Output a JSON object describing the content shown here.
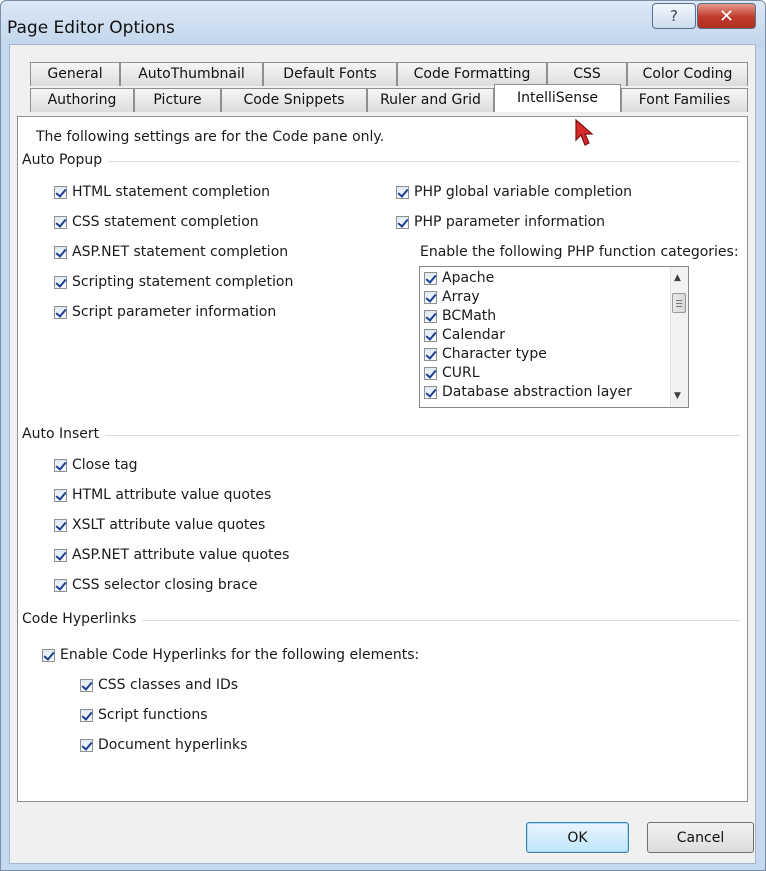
{
  "window": {
    "title": "Page Editor Options",
    "help_glyph": "?",
    "close_glyph": "✕"
  },
  "tabs": {
    "row1": [
      "General",
      "AutoThumbnail",
      "Default Fonts",
      "Code Formatting",
      "CSS",
      "Color Coding"
    ],
    "row2": [
      "Authoring",
      "Picture",
      "Code Snippets",
      "Ruler and Grid",
      "IntelliSense",
      "Font Families"
    ],
    "active": "IntelliSense"
  },
  "panel": {
    "intro": "The following settings are for the Code pane only.",
    "auto_popup": {
      "heading": "Auto Popup",
      "left_options": [
        "HTML statement completion",
        "CSS statement completion",
        "ASP.NET statement completion",
        "Scripting statement completion",
        "Script parameter information"
      ],
      "right_options": [
        "PHP global variable completion",
        "PHP parameter information"
      ],
      "php_label": "Enable the following PHP function categories:",
      "php_categories": [
        "Apache",
        "Array",
        "BCMath",
        "Calendar",
        "Character type",
        "CURL",
        "Database abstraction layer"
      ]
    },
    "auto_insert": {
      "heading": "Auto Insert",
      "options": [
        "Close tag",
        "HTML attribute value quotes",
        "XSLT attribute value quotes",
        "ASP.NET attribute value quotes",
        "CSS selector closing brace"
      ]
    },
    "code_hyperlinks": {
      "heading": "Code Hyperlinks",
      "enable": "Enable Code Hyperlinks for the following elements:",
      "options": [
        "CSS classes and IDs",
        "Script functions",
        "Document hyperlinks"
      ]
    },
    "all_checked": true
  },
  "buttons": {
    "ok": "OK",
    "cancel": "Cancel"
  },
  "colors": {
    "title_bar": "#c5d9ee",
    "close_button": "#c0392b",
    "check_mark": "#1c3f93",
    "ok_button": "#bee6fd"
  }
}
